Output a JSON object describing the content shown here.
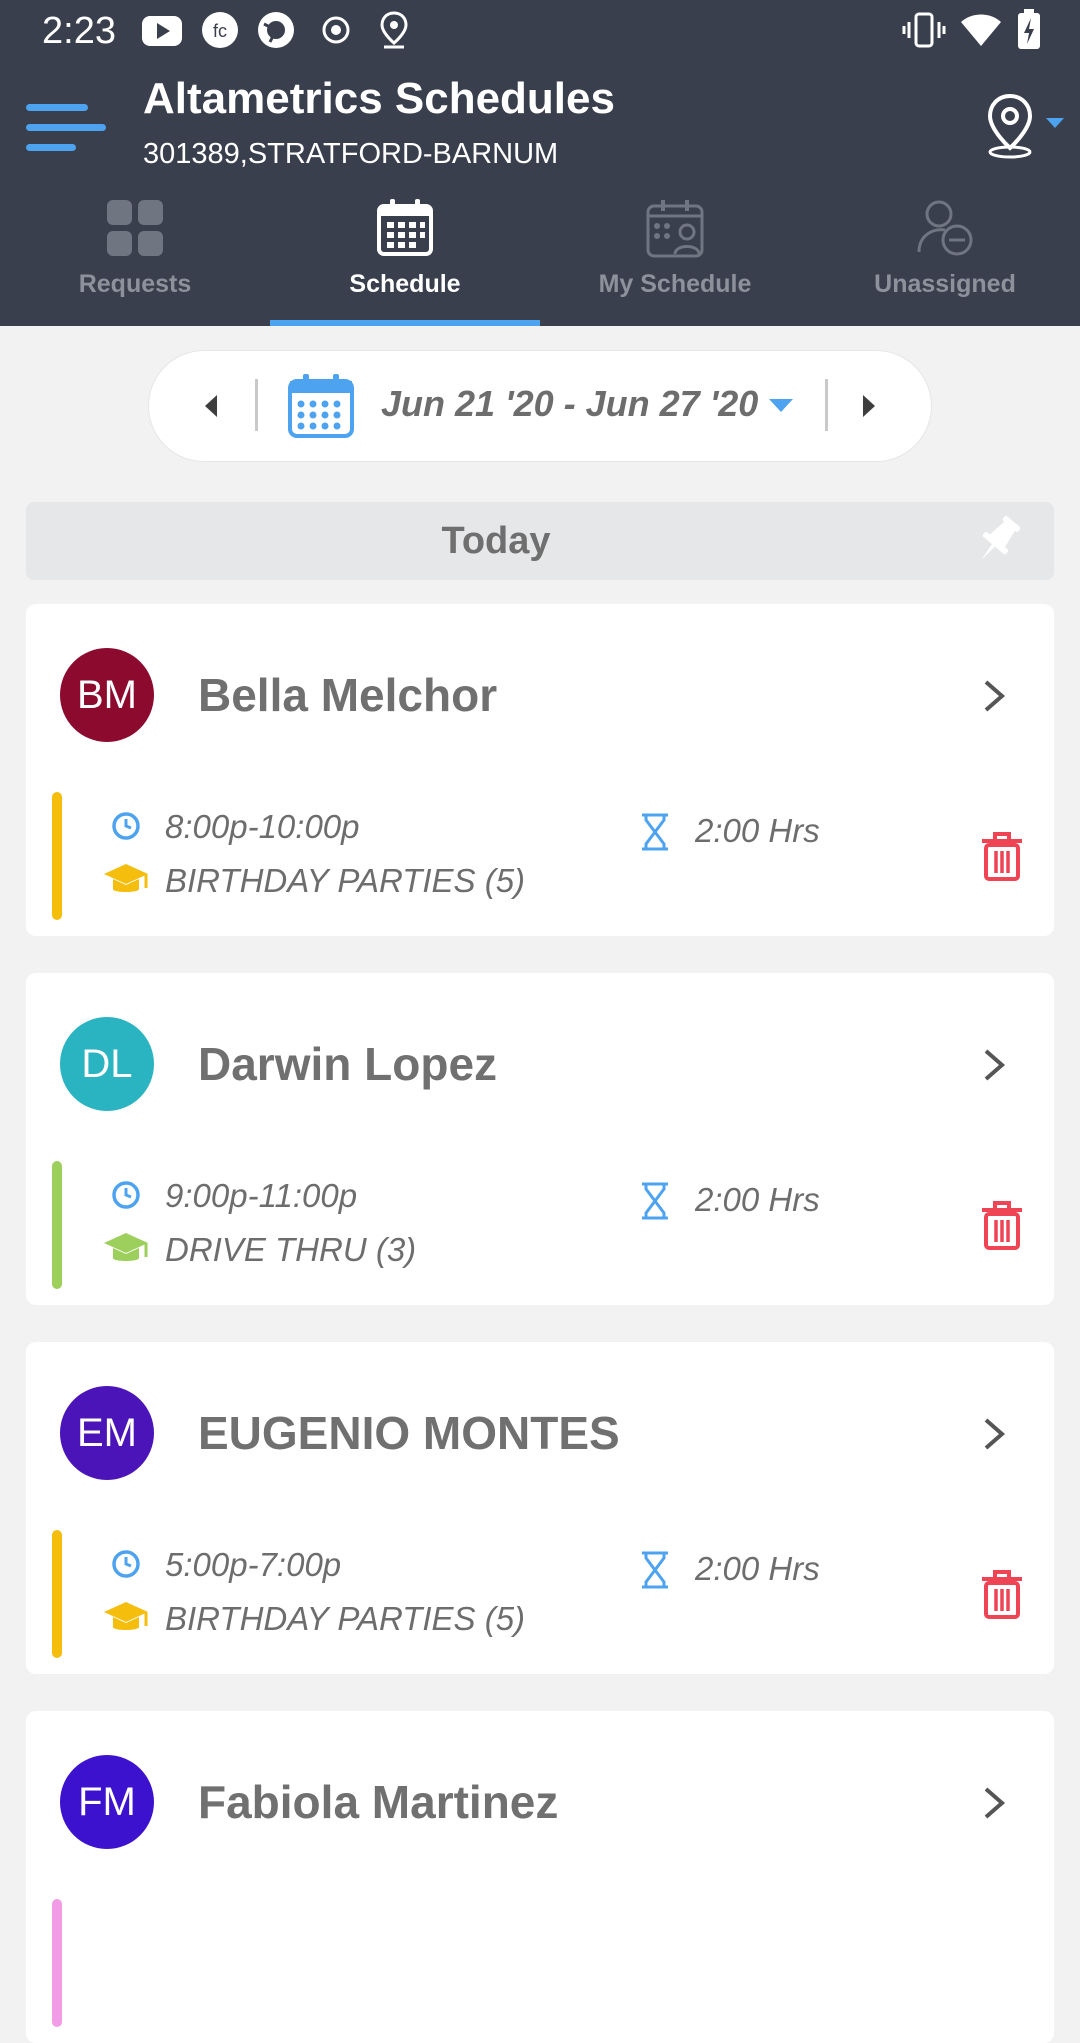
{
  "status_bar": {
    "time": "2:23",
    "left_icons": [
      "youtube-icon",
      "fc-app-icon",
      "camera-app-icon",
      "record-icon",
      "location-pin-icon"
    ],
    "right_icons": [
      "vibrate-icon",
      "wifi-icon",
      "battery-charging-icon"
    ]
  },
  "app": {
    "title": "Altametrics Schedules",
    "subtitle": "301389,STRATFORD-BARNUM",
    "accent_color": "#4da3f0",
    "header_color": "#3a3f4d"
  },
  "tabs": [
    {
      "label": "Requests",
      "icon": "grid-icon",
      "active": false
    },
    {
      "label": "Schedule",
      "icon": "calendar-icon",
      "active": true
    },
    {
      "label": "My Schedule",
      "icon": "calendar-person-icon",
      "active": false
    },
    {
      "label": "Unassigned",
      "icon": "person-minus-icon",
      "active": false
    }
  ],
  "date_selector": {
    "range": "Jun 21 '20 - Jun 27 '20"
  },
  "section": {
    "label": "Today"
  },
  "shifts": [
    {
      "initials": "BM",
      "name": "Bella Melchor",
      "avatar_color": "#8b0a2e",
      "time": "8:00p-10:00p",
      "role": "BIRTHDAY PARTIES (5)",
      "hours": "2:00 Hrs",
      "role_color": "#f5bd0c"
    },
    {
      "initials": "DL",
      "name": "Darwin Lopez",
      "avatar_color": "#2ab3c1",
      "time": "9:00p-11:00p",
      "role": "DRIVE THRU (3)",
      "hours": "2:00 Hrs",
      "role_color": "#9ccf5b"
    },
    {
      "initials": "EM",
      "name": "EUGENIO MONTES",
      "avatar_color": "#4a14b8",
      "time": "5:00p-7:00p",
      "role": "BIRTHDAY PARTIES (5)",
      "hours": "2:00 Hrs",
      "role_color": "#f5bd0c"
    },
    {
      "initials": "FM",
      "name": "Fabiola Martinez",
      "avatar_color": "#3c12cf",
      "role_color": "#f29be6"
    }
  ]
}
